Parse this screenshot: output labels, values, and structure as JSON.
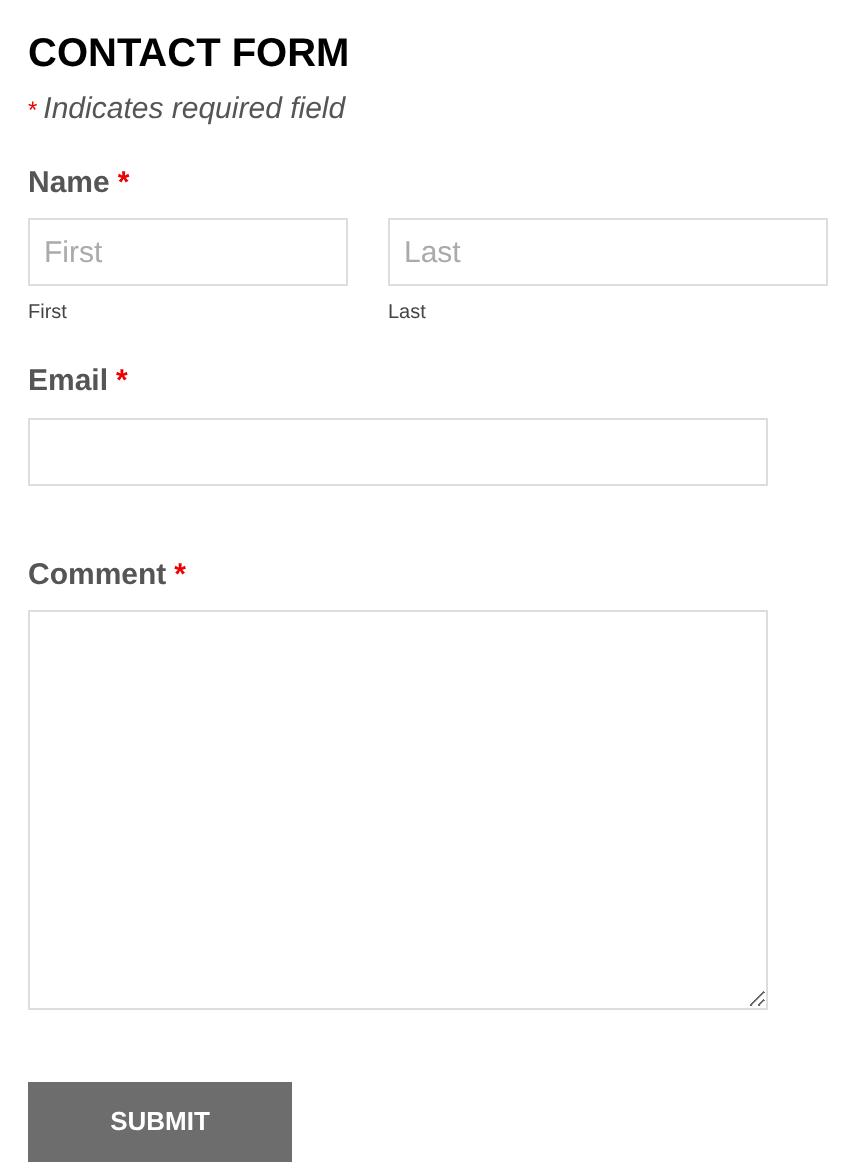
{
  "title": "CONTACT FORM",
  "required_note": {
    "mark": "*",
    "text": "Indicates required field"
  },
  "fields": [
    {
      "kind": "name",
      "label": "Name",
      "required": true,
      "parts": [
        {
          "placeholder": "First",
          "sublabel": "First"
        },
        {
          "placeholder": "Last",
          "sublabel": "Last"
        }
      ]
    },
    {
      "kind": "text",
      "label": "Email",
      "required": true
    },
    {
      "kind": "textarea",
      "label": "Comment",
      "required": true
    }
  ],
  "submit": "SUBMIT"
}
